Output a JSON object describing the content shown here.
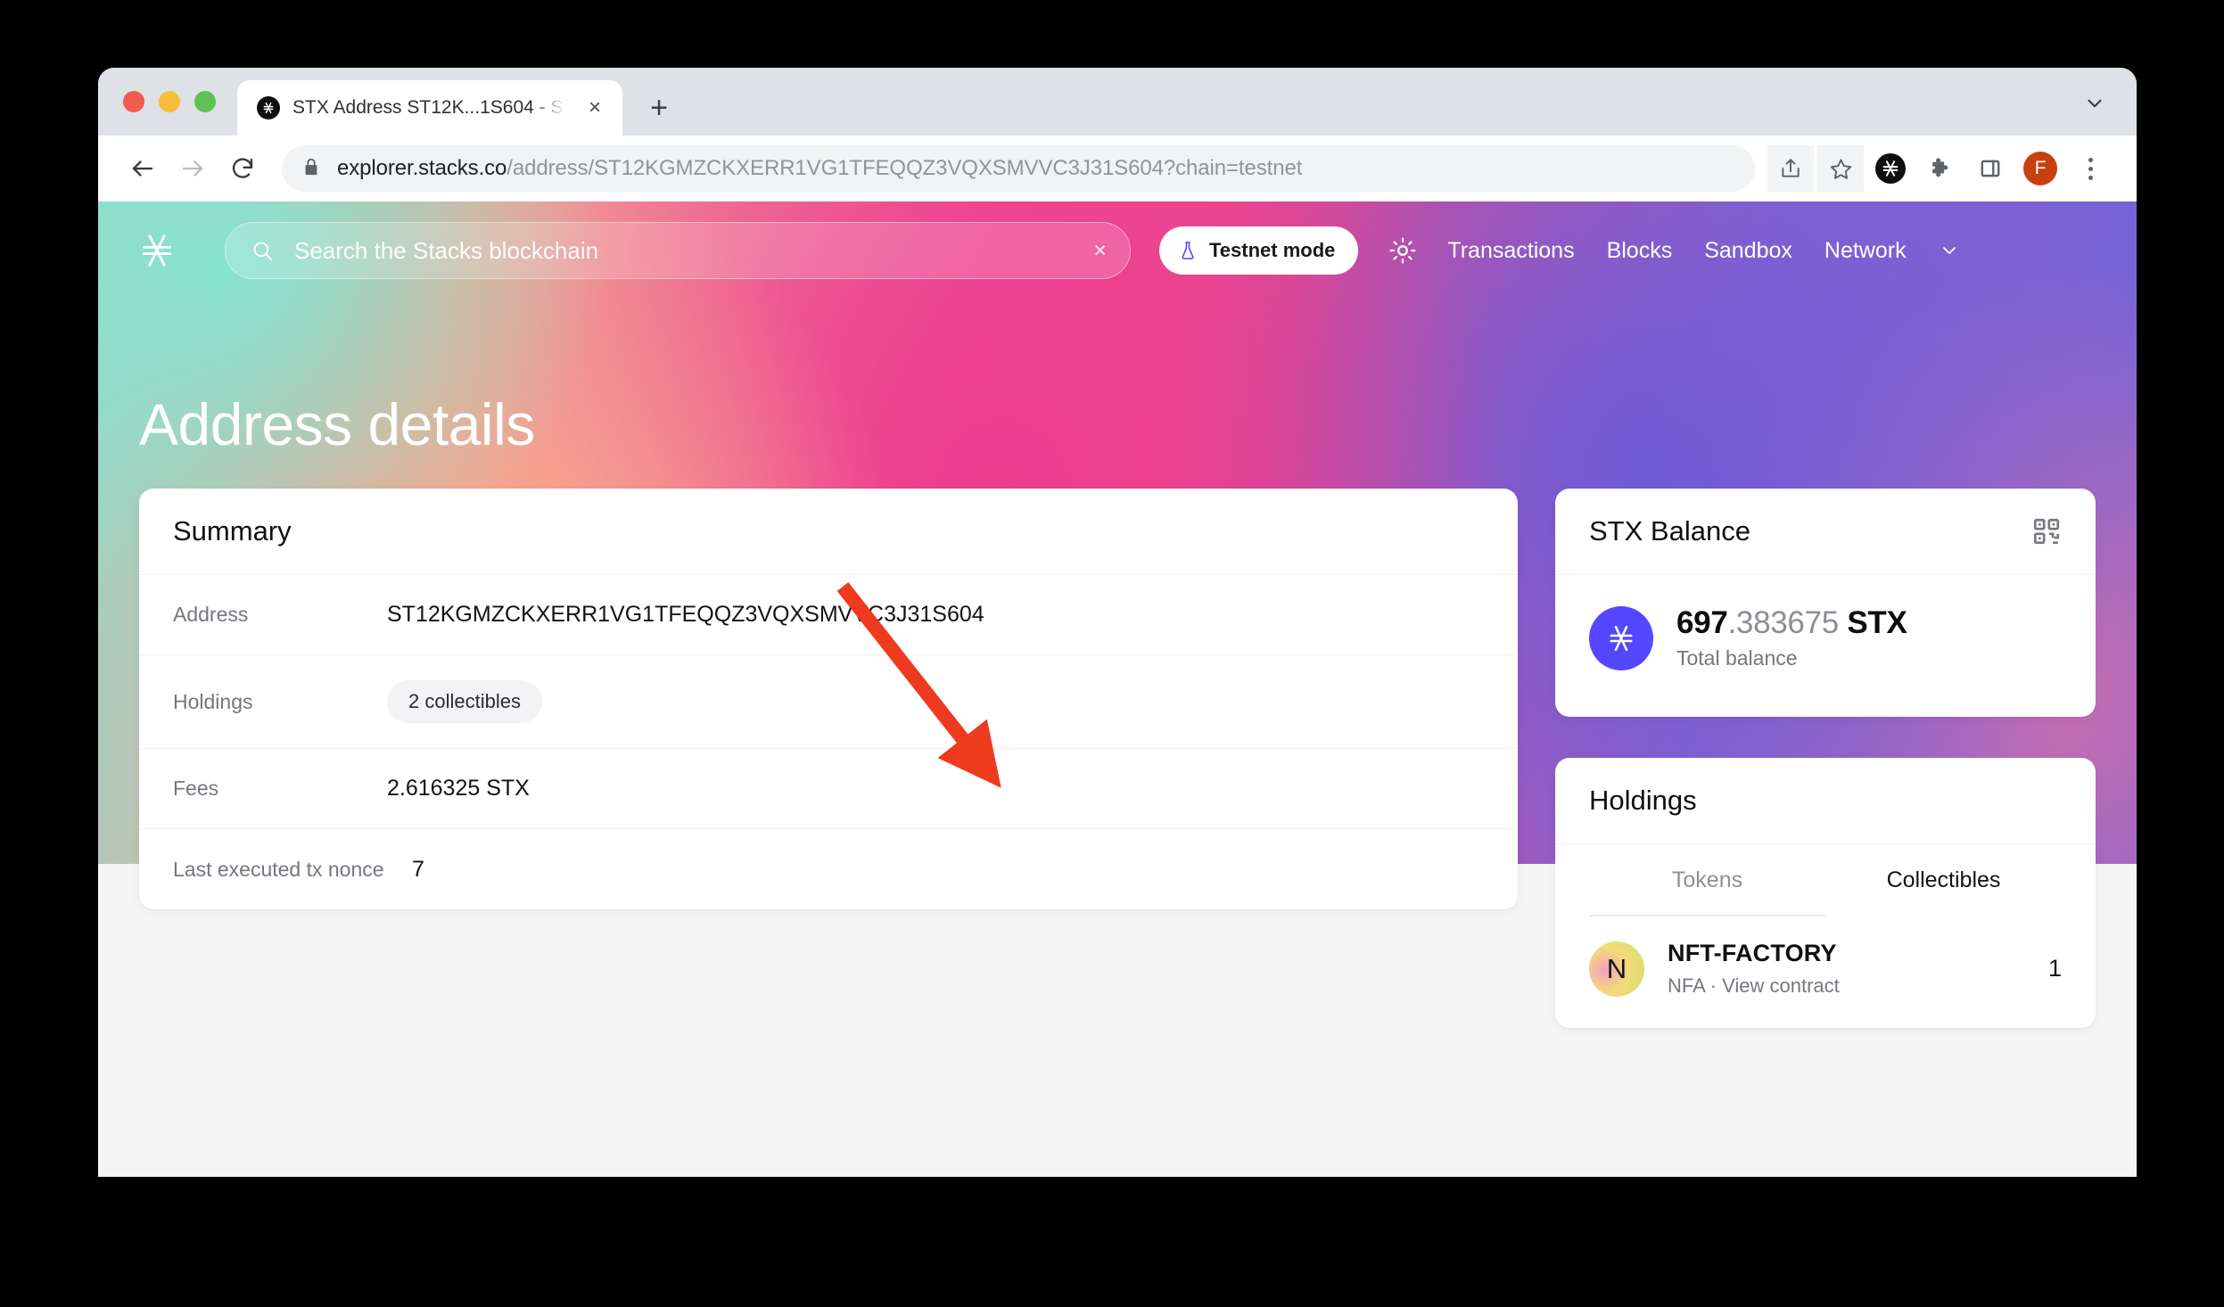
{
  "browser": {
    "tab": {
      "title": "STX Address ST12K...1S604 - S",
      "favicon": "stacks-icon",
      "close": "×"
    },
    "new_tab": "+",
    "toolbar": {
      "back": "back-arrow-icon",
      "forward": "forward-arrow-icon",
      "reload": "reload-icon",
      "lock": "lock-icon",
      "url_domain": "explorer.stacks.co",
      "url_path": "/address/ST12KGMZCKXERR1VG1TFEQQZ3VQXSMVVC3J31S604?chain=testnet",
      "share": "share-icon",
      "bookmark": "star-icon",
      "ext_stacks": "stacks-extension-icon",
      "ext_puzzle": "puzzle-icon",
      "side_panel": "side-panel-icon",
      "profile_initial": "F",
      "menu": "kebab-menu-icon"
    }
  },
  "site_nav": {
    "logo": "stacks-logo-icon",
    "search": {
      "placeholder": "Search the Stacks blockchain",
      "icon": "search-icon",
      "clear": "×"
    },
    "testnet": {
      "label": "Testnet mode",
      "icon": "flask-icon"
    },
    "theme_toggle": "sun-icon",
    "links": [
      "Transactions",
      "Blocks",
      "Sandbox",
      "Network"
    ],
    "network_caret": "chevron-down-icon"
  },
  "hero": {
    "title": "Address details"
  },
  "summary": {
    "heading": "Summary",
    "rows": [
      {
        "label": "Address",
        "value": "ST12KGMZCKXERR1VG1TFEQQZ3VQXSMVVC3J31S604"
      },
      {
        "label": "Holdings",
        "value": "2 collectibles"
      },
      {
        "label": "Fees",
        "value": "2.616325 STX"
      },
      {
        "label": "Last executed tx nonce",
        "value": "7"
      }
    ]
  },
  "balance": {
    "heading": "STX Balance",
    "qr_icon": "qr-code-icon",
    "token_icon": "stacks-token-icon",
    "whole": "697",
    "fraction": ".383675",
    "unit": " STX",
    "sublabel": "Total balance"
  },
  "holdings": {
    "heading": "Holdings",
    "tabs": [
      {
        "label": "Tokens",
        "active": false
      },
      {
        "label": "Collectibles",
        "active": true
      }
    ],
    "items": [
      {
        "avatar_letter": "N",
        "name": "NFT-FACTORY",
        "meta": "NFA  ·  View contract",
        "count": "1"
      }
    ]
  },
  "annotation": {
    "arrow_color": "#ee3b20"
  },
  "colors": {
    "stacks_purple": "#5546ff",
    "avatar_orange": "#c9400f",
    "arrow_red": "#ee3b20"
  }
}
